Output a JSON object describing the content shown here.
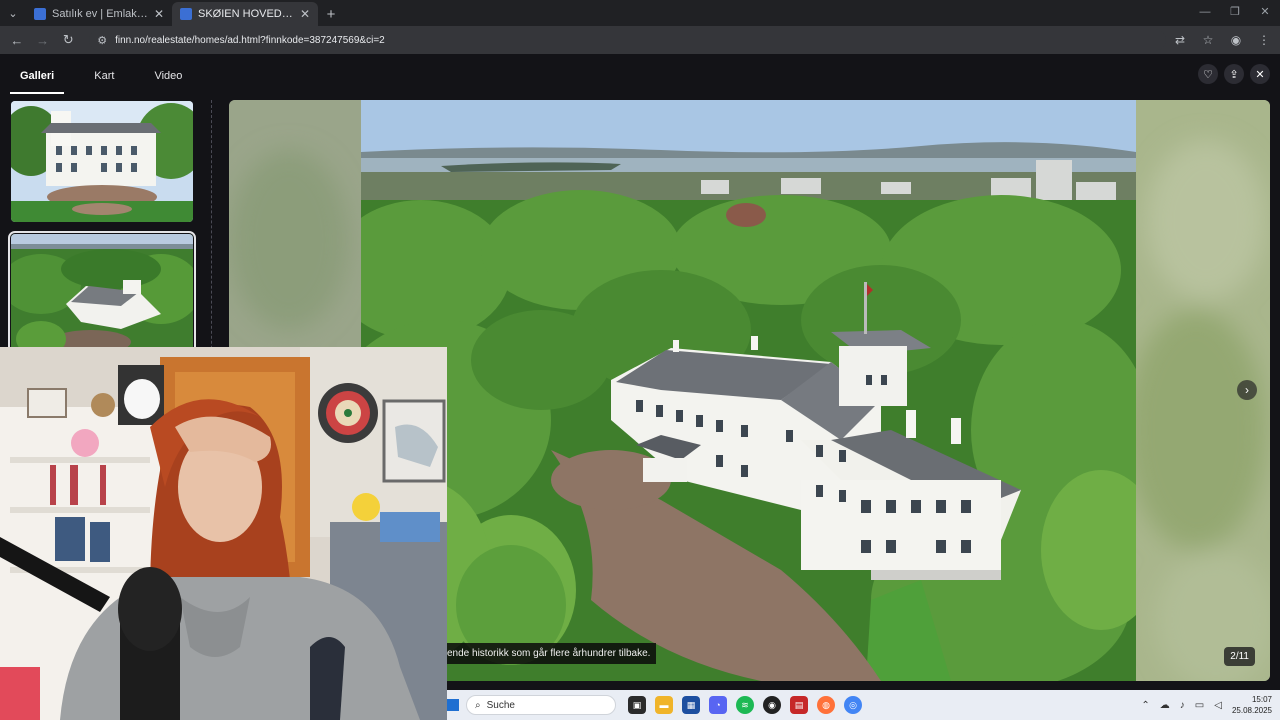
{
  "browser": {
    "tabs": [
      {
        "title": "Satılık ev | Emlak Bul",
        "active": false
      },
      {
        "title": "SKØIEN HOVEDGAARD|En unik eiendom med lang historie | FINN eiendom",
        "active": true
      }
    ],
    "url": "finn.no/realestate/homes/ad.html?finnkode=387247569&ci=2"
  },
  "gallery": {
    "tabs": [
      {
        "label": "Galleri",
        "active": true
      },
      {
        "label": "Kart",
        "active": false
      },
      {
        "label": "Video",
        "active": false
      }
    ],
    "counter": "2/11",
    "caption": "ende historikk som går flere århundrer tilbake."
  },
  "taskbar": {
    "search_label": "Suche",
    "time": "15:07",
    "date": "25.08.2025"
  },
  "colors": {
    "viewer_bg": "#131317",
    "chrome_bg": "#202124",
    "toolbar_bg": "#35363a",
    "taskbar_bg": "#e9edf4"
  }
}
